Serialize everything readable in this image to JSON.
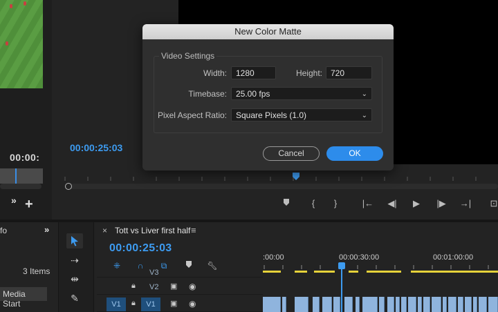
{
  "source_monitor": {
    "timecode": "00:00:"
  },
  "program_monitor": {
    "timecode": "00:00:25:03"
  },
  "dialog": {
    "title": "New Color Matte",
    "group_label": "Video Settings",
    "width_label": "Width:",
    "width_value": "1280",
    "height_label": "Height:",
    "height_value": "720",
    "timebase_label": "Timebase:",
    "timebase_value": "25.00 fps",
    "par_label": "Pixel Aspect Ratio:",
    "par_value": "Square Pixels (1.0)",
    "cancel_label": "Cancel",
    "ok_label": "OK"
  },
  "project_panel": {
    "tab_label": "fo",
    "items_count": "3 Items",
    "column_header": "Media Start"
  },
  "timeline": {
    "sequence_name": "Tott vs Liver first half",
    "timecode": "00:00:25:03",
    "ruler_labels": [
      ":00:00",
      "00:00:30:00",
      "00:01:00:00"
    ],
    "tracks": [
      {
        "name": "V3",
        "target": ""
      },
      {
        "name": "V2",
        "target": ""
      },
      {
        "name": "V1",
        "target": "V1"
      }
    ]
  },
  "colors": {
    "accent": "#3d9bf0",
    "ok_button": "#2d8ceb",
    "clip": "#8fb4dd",
    "work_area": "#e6d23a"
  },
  "icons": [
    "chevron-down-icon",
    "double-chevron-icon",
    "add-icon",
    "selection-tool-icon",
    "track-select-icon",
    "ripple-edit-icon",
    "razor-icon",
    "snap-icon",
    "linked-selection-icon",
    "marker-icon",
    "wrench-icon",
    "lock-icon",
    "camera-icon",
    "eye-icon",
    "play-icon",
    "step-back-icon",
    "step-forward-icon",
    "mark-in-icon",
    "mark-out-icon",
    "go-to-in-icon",
    "go-to-out-icon"
  ]
}
